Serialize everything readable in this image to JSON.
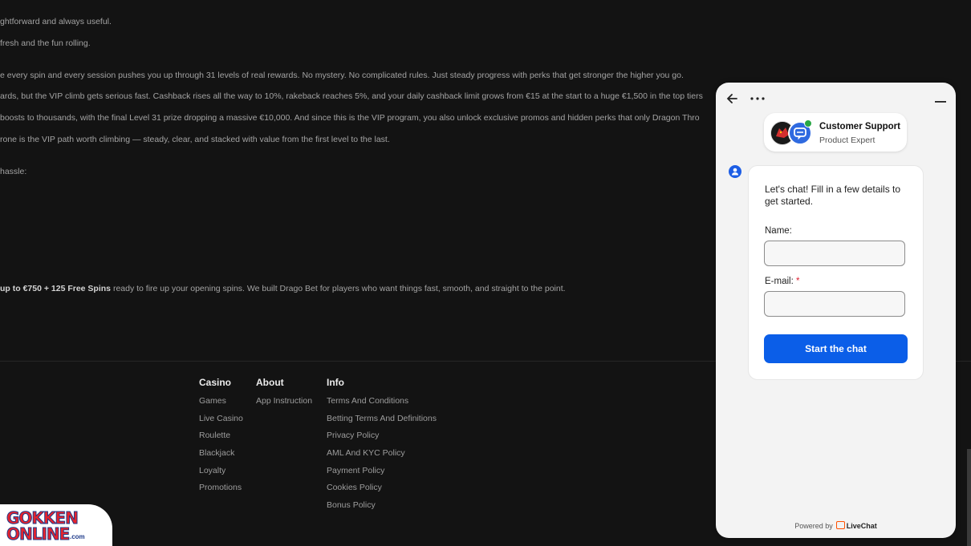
{
  "article": {
    "lines": [
      "ghtforward and always useful.",
      "fresh and the fun rolling.",
      "e every spin and every session pushes you up through 31 levels of real rewards. No mystery. No complicated rules. Just steady progress with perks that get stronger the higher you go.",
      "ards, but the VIP climb gets serious fast. Cashback rises all the way to 10%, rakeback reaches 5%, and your daily cashback limit grows from €15 at the start to a huge €1,500 in the top tiers",
      "boosts to thousands, with the final Level 31 prize dropping a massive €10,000. And since this is the VIP program, you also unlock exclusive promos and hidden perks that only Dragon Thro",
      "rone is the VIP path worth climbing — steady, clear, and stacked with value from the first level to the last.",
      "hassle:"
    ],
    "final_bold": "up to €750 + 125 Free Spins",
    "final_rest": " ready to fire up your opening spins. We built Drago Bet for players who want things fast, smooth, and straight to the point."
  },
  "footer": {
    "casino": {
      "heading": "Casino",
      "links": [
        "Games",
        "Live Casino",
        "Roulette",
        "Blackjack",
        "Loyalty",
        "Promotions"
      ]
    },
    "about": {
      "heading": "About",
      "links": [
        "App Instruction"
      ]
    },
    "info": {
      "heading": "Info",
      "links": [
        "Terms And Conditions",
        "Betting Terms And Definitions",
        "Privacy Policy",
        "AML And KYC Policy",
        "Payment Policy",
        "Cookies Policy",
        "Bonus Policy"
      ]
    }
  },
  "logo": {
    "line1": "GOKKEN",
    "line2": "ONLINE",
    "suffix": ".com"
  },
  "chat": {
    "agent_name": "Customer Support",
    "agent_role": "Product Expert",
    "intro": "Let's chat! Fill in a few details to get started.",
    "name_label": "Name:",
    "email_label": "E-mail:",
    "required_mark": "*",
    "name_value": "",
    "email_value": "",
    "start_button": "Start the chat",
    "powered_by": "Powered by",
    "powered_brand": "LiveChat",
    "colors": {
      "primary": "#0b5ee8",
      "online": "#28a745",
      "brand": "#ff5100"
    }
  }
}
